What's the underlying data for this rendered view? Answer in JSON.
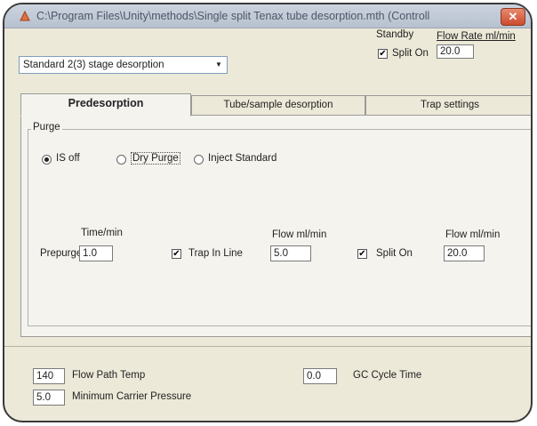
{
  "window": {
    "title": "C:\\Program Files\\Unity\\methods\\Single split Tenax tube desorption.mth (Controll",
    "close_label": "✕"
  },
  "method_select": {
    "value": "Standard 2(3) stage desorption"
  },
  "standby": {
    "label": "Standby",
    "split_on_label": "Split On",
    "split_on_checked": true,
    "flow_label": "Flow Rate ml/min",
    "flow_value": "20.0"
  },
  "tabs": [
    {
      "label": "Predesorption",
      "active": true
    },
    {
      "label": "Tube/sample desorption",
      "active": false
    },
    {
      "label": "Trap settings",
      "active": false
    }
  ],
  "purge": {
    "group_label": "Purge",
    "options": [
      {
        "label": "IS off",
        "selected": true
      },
      {
        "label": "Dry Purge",
        "selected": false
      },
      {
        "label": "Inject Standard",
        "selected": false
      }
    ]
  },
  "prepurge": {
    "label": "Prepurge",
    "time_label": "Time/min",
    "time_value": "1.0",
    "trap_in_line_label": "Trap In Line",
    "trap_in_line_checked": true,
    "flow_label": "Flow  ml/min",
    "flow_value": "5.0",
    "split_on_label": "Split On",
    "split_on_checked": true,
    "split_flow_label": "Flow  ml/min",
    "split_flow_value": "20.0"
  },
  "bottom": {
    "flow_path_temp_value": "140",
    "flow_path_temp_label": "Flow Path Temp",
    "gc_cycle_value": "0.0",
    "gc_cycle_label": "GC Cycle Time",
    "min_carrier_value": "5.0",
    "min_carrier_label": "Minimum Carrier Pressure"
  },
  "colors": {
    "accent": "#cc4a2e",
    "window_bg": "#ece9d8",
    "titlebar": "#b7c1cf"
  }
}
